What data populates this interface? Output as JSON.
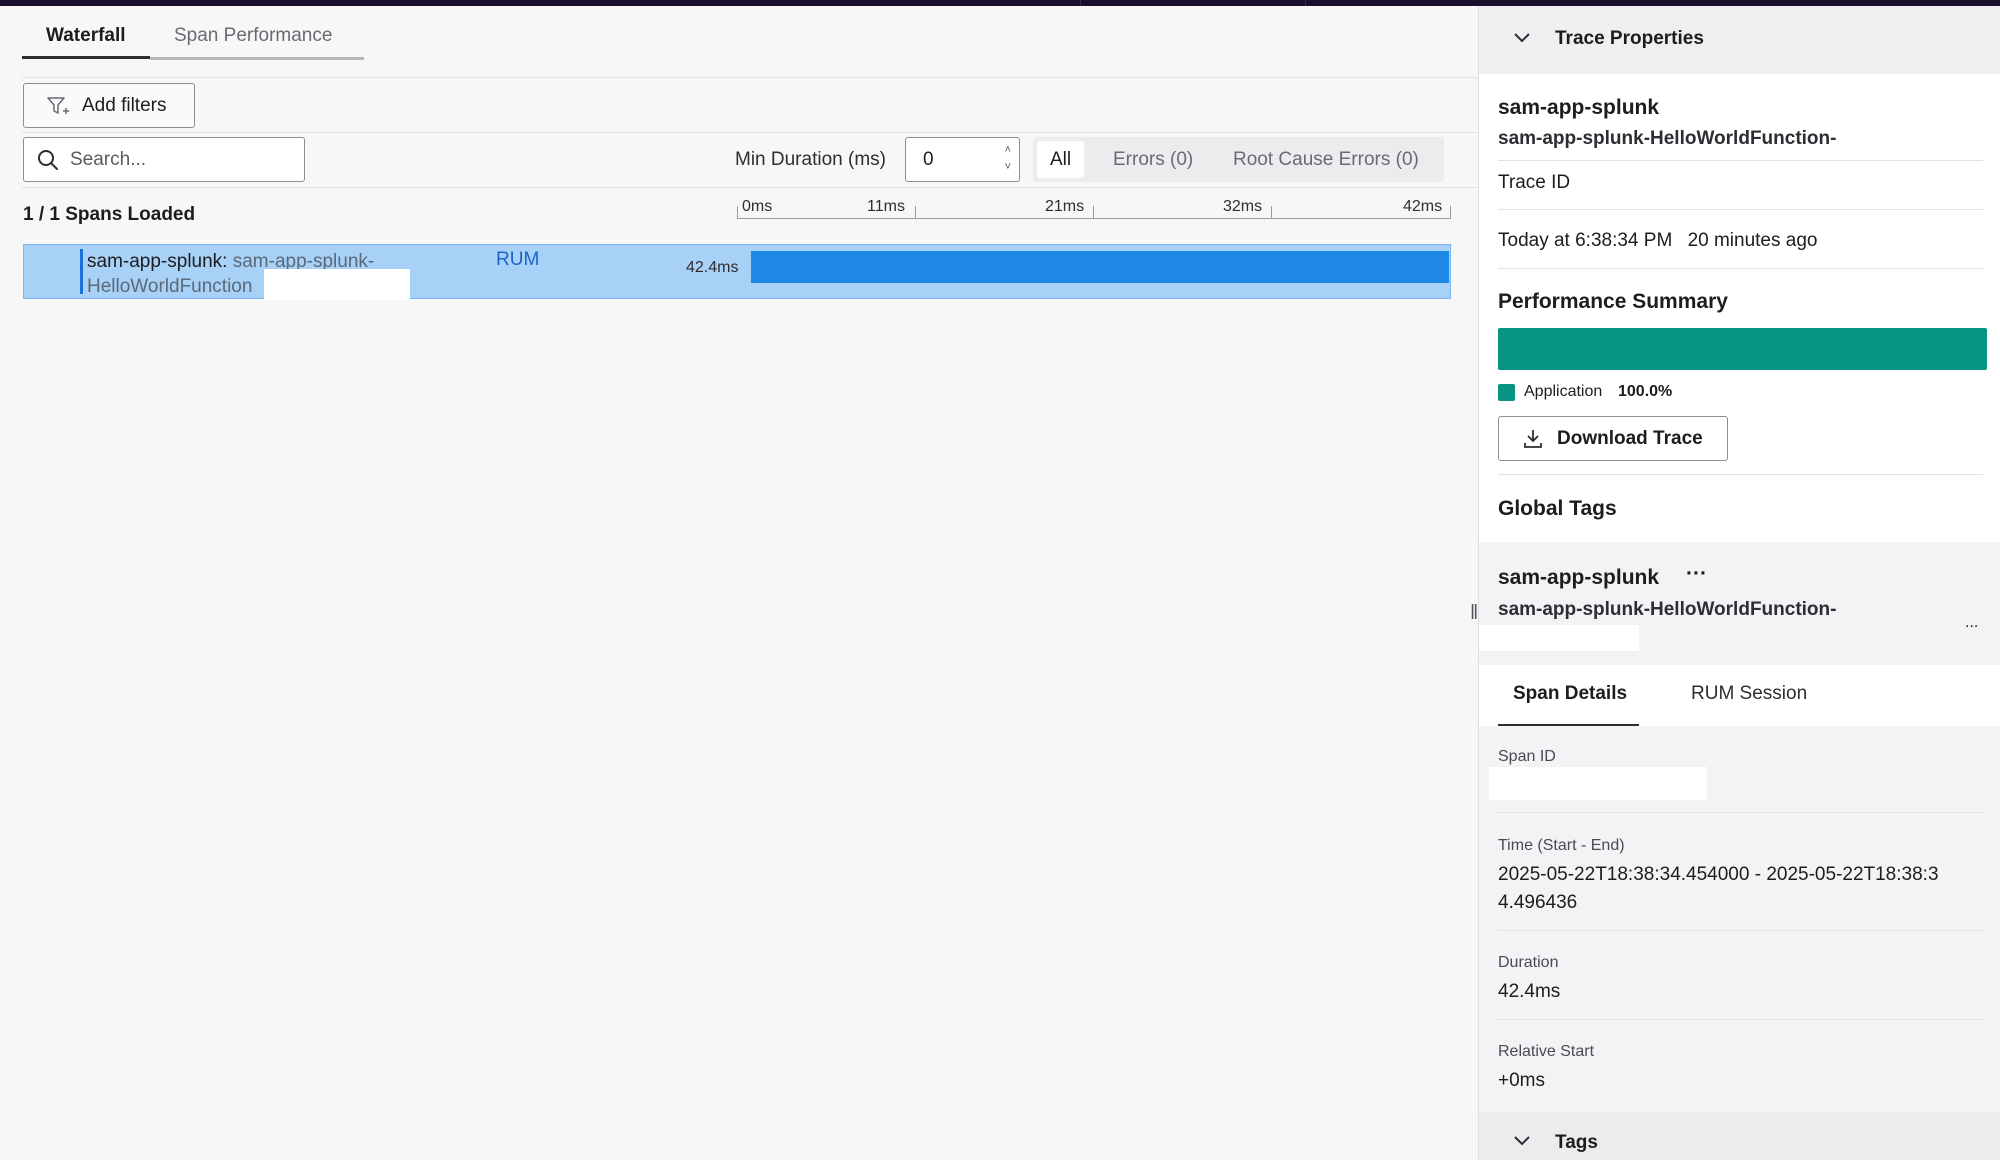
{
  "tabs": [
    {
      "label": "Waterfall",
      "active": true
    },
    {
      "label": "Span Performance",
      "active": false
    }
  ],
  "toolbar": {
    "add_filters_label": "Add filters",
    "search_placeholder": "Search...",
    "min_duration_label": "Min Duration (ms)",
    "min_duration_value": "0",
    "segment": {
      "all": "All",
      "errors": "Errors (0)",
      "root_cause_errors": "Root Cause Errors (0)"
    }
  },
  "spans_loaded": "1 / 1 Spans Loaded",
  "timeline": {
    "ticks": [
      "0ms",
      "11ms",
      "21ms",
      "32ms",
      "42ms"
    ]
  },
  "span_row": {
    "service": "sam-app-splunk:",
    "operation_line1": "sam-app-splunk-",
    "operation_line2": "HelloWorldFunction",
    "badge": "RUM",
    "duration": "42.4ms",
    "bar_fraction": 1.0,
    "bar_color": "#1e88e5"
  },
  "right_panel": {
    "header_title": "Trace Properties",
    "service_name": "sam-app-splunk",
    "operation_name": "sam-app-splunk-HelloWorldFunction-",
    "trace_id_label": "Trace ID",
    "time_today": "Today at 6:38:34 PM",
    "time_ago": "20 minutes ago",
    "perf_summary_title": "Performance Summary",
    "perf": {
      "label": "Application",
      "percent": "100.0%",
      "fraction": 1.0,
      "color": "#079483"
    },
    "download_label": "Download Trace",
    "global_tags_title": "Global Tags",
    "span_service": "sam-app-splunk",
    "span_more": "···",
    "span_operation": "sam-app-splunk-HelloWorldFunction-",
    "span_ellipsis": "...",
    "detail_tabs": [
      {
        "label": "Span Details",
        "active": true
      },
      {
        "label": "RUM Session",
        "active": false
      }
    ],
    "span_id_label": "Span ID",
    "time_range_label": "Time (Start - End)",
    "time_range_line1": "2025-05-22T18:38:34.454000 - 2025-05-22T18:38:3",
    "time_range_line2": "4.496436",
    "duration_label": "Duration",
    "duration_value": "42.4ms",
    "relative_start_label": "Relative Start",
    "relative_start_value": "+0ms",
    "tags_title": "Tags"
  }
}
